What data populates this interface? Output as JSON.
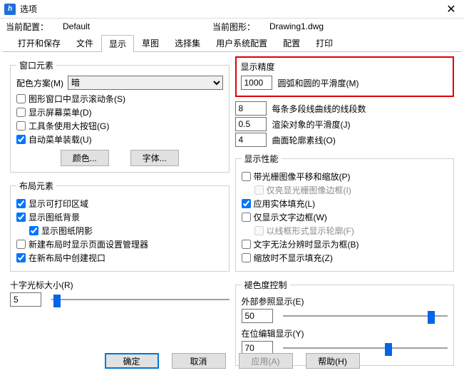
{
  "window": {
    "icon": "h",
    "title": "选项",
    "close": "✕"
  },
  "header": {
    "curConfigLabel": "当前配置：",
    "curConfigValue": "Default",
    "curDrawingLabel": "当前图形：",
    "curDrawingValue": "Drawing1.dwg"
  },
  "tabs": [
    "打开和保存",
    "文件",
    "显示",
    "草图",
    "选择集",
    "用户系统配置",
    "配置",
    "打印"
  ],
  "activeTab": 2,
  "winElem": {
    "legend": "窗口元素",
    "colorSchemeLabel": "配色方案(M)",
    "colorSchemeValue": "暗",
    "c1": "图形窗口中显示滚动条(S)",
    "c2": "显示屏幕菜单(D)",
    "c3": "工具条使用大按钮(G)",
    "c4": "自动菜单装载(U)",
    "btnColor": "颜色...",
    "btnFont": "字体..."
  },
  "layoutElem": {
    "legend": "布局元素",
    "c1": "显示可打印区域",
    "c2": "显示图纸背景",
    "c3": "显示图纸阴影",
    "c4": "新建布局时显示页面设置管理器",
    "c5": "在新布局中创建视口"
  },
  "crosshair": {
    "label": "十字光标大小(R)",
    "value": "5"
  },
  "precision": {
    "legend": "显示精度",
    "v1": "1000",
    "l1": "圆弧和圆的平滑度(M)",
    "v2": "8",
    "l2": "每条多段线曲线的线段数",
    "v3": "0.5",
    "l3": "渲染对象的平滑度(J)",
    "v4": "4",
    "l4": "曲面轮廓素线(O)"
  },
  "perf": {
    "legend": "显示性能",
    "c1": "带光栅图像平移和缩放(P)",
    "c2": "仅亮显光栅图像边框(I)",
    "c3": "应用实体填充(L)",
    "c4": "仅显示文字边框(W)",
    "c5": "以线框形式显示轮廓(F)",
    "c6": "文字无法分辨时显示为框(B)",
    "c7": "缩放时不显示填充(Z)"
  },
  "fade": {
    "legend": "褪色度控制",
    "l1": "外部参照显示(E)",
    "v1": "50",
    "l2": "在位编辑显示(Y)",
    "v2": "70"
  },
  "footer": {
    "ok": "确定",
    "cancel": "取消",
    "apply": "应用(A)",
    "help": "帮助(H)"
  }
}
